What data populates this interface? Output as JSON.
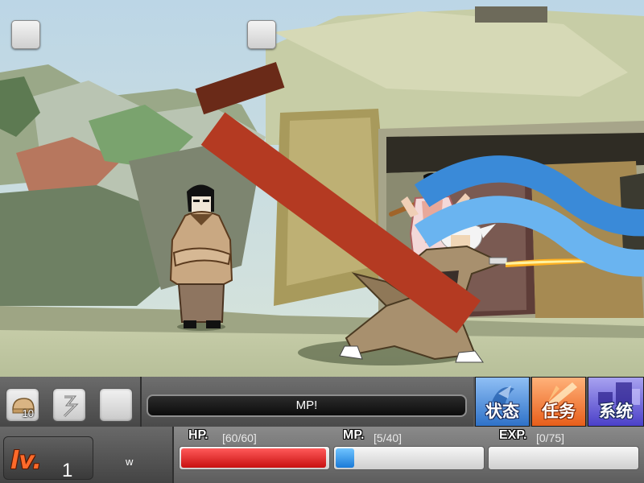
{
  "item_bar": {
    "slots": [
      {
        "icon": "bread-icon",
        "count": "10"
      },
      {
        "icon": "scroll-icon",
        "count": ""
      },
      {
        "icon": "empty-slot",
        "count": ""
      }
    ]
  },
  "message": "MP!",
  "menu": {
    "status_label": "状态",
    "quest_label": "任务",
    "system_label": "系统"
  },
  "player": {
    "level_label": "lv.",
    "level": "1",
    "hotkey": "w",
    "hp_label": "HP.",
    "hp_text": "[60/60]",
    "hp_fraction": 1.0,
    "mp_label": "MP.",
    "mp_text": "[5/40]",
    "mp_fraction": 0.125,
    "exp_label": "EXP.",
    "exp_text": "[0/75]",
    "exp_fraction": 0.0
  },
  "scene_icons": {
    "top_left": "sword-skill-icon",
    "top_center": "wind-skill-icon"
  },
  "colors": {
    "hp": "#d01818",
    "mp": "#1a7ad8",
    "status_btn": "#3a7fd0",
    "quest_btn": "#ee6a22",
    "system_btn": "#5a4fd0"
  }
}
